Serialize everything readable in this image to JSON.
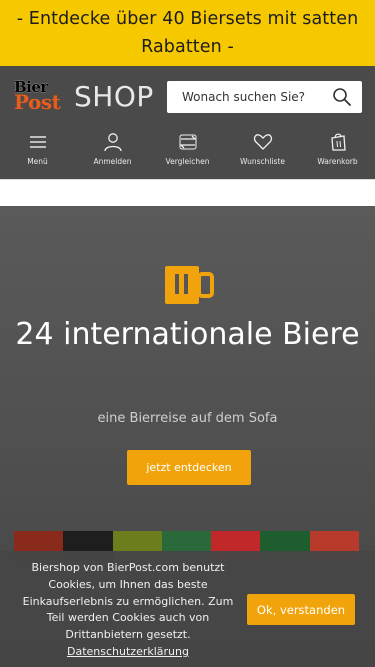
{
  "promo": {
    "text": "- Entdecke über 40 Biersets mit satten Rabatten -"
  },
  "logo": {
    "bier": "Bier",
    "post": "Post",
    "shop": "SHOP"
  },
  "search": {
    "placeholder": "Wonach suchen Sie?",
    "icon": "search-icon"
  },
  "nav": [
    {
      "label": "Menü",
      "icon": "menu-icon"
    },
    {
      "label": "Anmelden",
      "icon": "user-icon"
    },
    {
      "label": "Vergleichen",
      "icon": "compare-icon"
    },
    {
      "label": "Wunschliste",
      "icon": "heart-icon"
    },
    {
      "label": "Warenkorb",
      "icon": "shopping-bag-icon"
    }
  ],
  "hero": {
    "icon": "beer-mug-icon",
    "title": "24 internationale Biere",
    "subtitle": "eine Bierreise auf dem Sofa",
    "cta": "jetzt entdecken"
  },
  "cookie": {
    "text": "Biershop von BierPost.com benutzt Cookies, um Ihnen das beste Einkaufserlebnis zu ermöglichen. Zum Teil werden Cookies auch von Drittanbietern gesetzt.",
    "link": "Datenschutzerklärung",
    "accept": "Ok, verstanden"
  },
  "colors": {
    "promo_bg": "#f5c800",
    "header_bg": "#4a4a4a",
    "accent": "#f0a30a",
    "logo_post": "#e95c1b"
  }
}
